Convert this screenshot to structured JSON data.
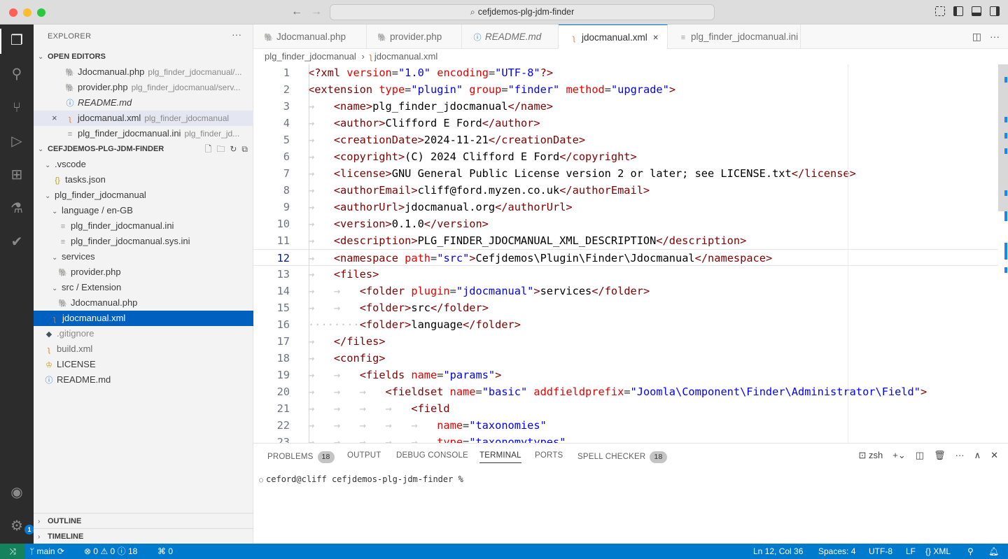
{
  "window": {
    "title": "cefjdemos-plg-jdm-finder"
  },
  "sidebar": {
    "title": "EXPLORER",
    "more": "···",
    "open_editors": {
      "label": "OPEN EDITORS",
      "items": [
        {
          "name": "Jdocmanual.php",
          "desc": "plg_finder_jdocmanual/..."
        },
        {
          "name": "provider.php",
          "desc": "plg_finder_jdocmanual/serv..."
        },
        {
          "name": "README.md",
          "desc": ""
        },
        {
          "name": "jdocmanual.xml",
          "desc": "plg_finder_jdocmanual"
        },
        {
          "name": "plg_finder_jdocmanual.ini",
          "desc": "plg_finder_jd..."
        }
      ]
    },
    "project": {
      "label": "CEFJDEMOS-PLG-JDM-FINDER",
      "items": [
        {
          "name": ".vscode"
        },
        {
          "name": "tasks.json"
        },
        {
          "name": "plg_finder_jdocmanual"
        },
        {
          "name": "language / en-GB"
        },
        {
          "name": "plg_finder_jdocmanual.ini"
        },
        {
          "name": "plg_finder_jdocmanual.sys.ini"
        },
        {
          "name": "services"
        },
        {
          "name": "provider.php"
        },
        {
          "name": "src / Extension"
        },
        {
          "name": "Jdocmanual.php"
        },
        {
          "name": "jdocmanual.xml"
        },
        {
          "name": ".gitignore"
        },
        {
          "name": "build.xml"
        },
        {
          "name": "LICENSE"
        },
        {
          "name": "README.md"
        }
      ]
    },
    "outline": "OUTLINE",
    "timeline": "TIMELINE"
  },
  "tabs": [
    {
      "label": "Jdocmanual.php",
      "icon": "php-icon"
    },
    {
      "label": "provider.php",
      "icon": "php-icon"
    },
    {
      "label": "README.md",
      "icon": "info-icon"
    },
    {
      "label": "jdocmanual.xml",
      "icon": "rss-icon",
      "close": "×"
    },
    {
      "label": "plg_finder_jdocmanual.ini",
      "icon": "ini-icon"
    }
  ],
  "breadcrumb": {
    "folder": "plg_finder_jdocmanual",
    "file": "jdocmanual.xml"
  },
  "editor": {
    "line_numbers": [
      "1",
      "2",
      "3",
      "4",
      "5",
      "6",
      "7",
      "8",
      "9",
      "10",
      "11",
      "12",
      "13",
      "14",
      "15",
      "16",
      "17",
      "18",
      "19",
      "20",
      "21",
      "22",
      "23"
    ],
    "current_line": "12"
  },
  "panel": {
    "tabs": [
      "PROBLEMS",
      "OUTPUT",
      "DEBUG CONSOLE",
      "TERMINAL",
      "PORTS",
      "SPELL CHECKER"
    ],
    "problems_count": "18",
    "spell_count": "18",
    "shell": "zsh",
    "prompt": "ceford@cliff cefjdemos-plg-jdm-finder %"
  },
  "status": {
    "branch": "main",
    "errors": "0",
    "warnings": "0",
    "info": "18",
    "ports": "0",
    "position": "Ln 12, Col 36",
    "spaces": "Spaces: 4",
    "encoding": "UTF-8",
    "eol": "LF",
    "language": "XML"
  },
  "accent_colors": {
    "status_bar": "#007acc",
    "selection": "#0060c0",
    "remote": "#16825d"
  }
}
